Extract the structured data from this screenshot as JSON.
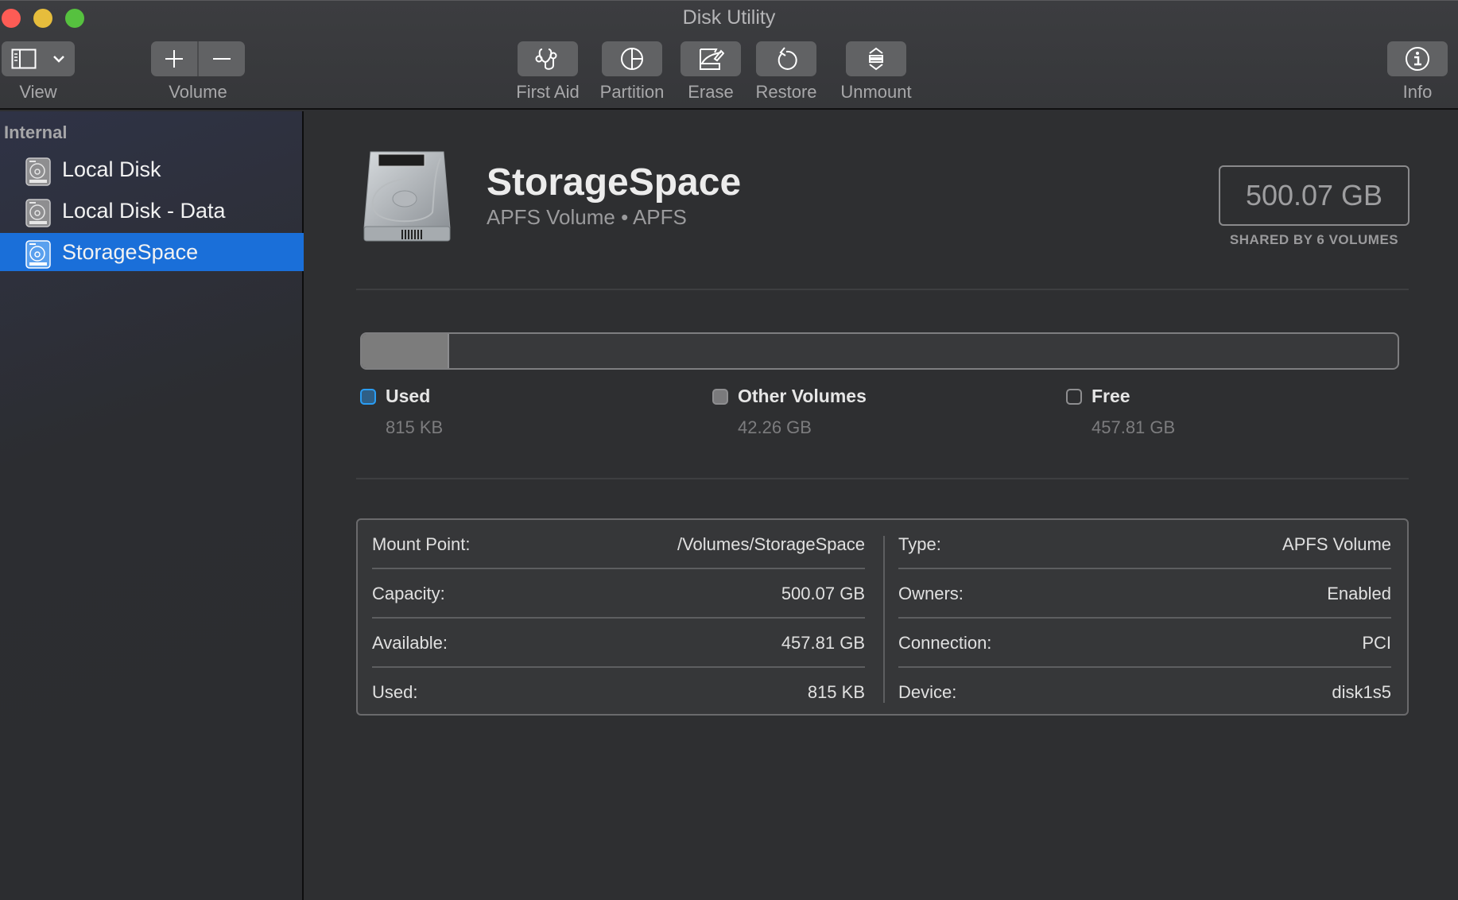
{
  "window": {
    "title": "Disk Utility"
  },
  "toolbar": {
    "view_label": "View",
    "volume_label": "Volume",
    "first_aid_label": "First Aid",
    "partition_label": "Partition",
    "erase_label": "Erase",
    "restore_label": "Restore",
    "unmount_label": "Unmount",
    "info_label": "Info"
  },
  "sidebar": {
    "section": "Internal",
    "items": [
      {
        "label": "Local Disk",
        "icon": "hard-disk-icon",
        "selected": false
      },
      {
        "label": "Local Disk - Data",
        "icon": "hard-disk-icon",
        "selected": false
      },
      {
        "label": "StorageSpace",
        "icon": "hard-disk-icon",
        "selected": true
      }
    ]
  },
  "volume": {
    "name": "StorageSpace",
    "subtitle": "APFS Volume • APFS",
    "capacity": "500.07 GB",
    "shared_note": "SHARED BY 6 VOLUMES"
  },
  "usage": {
    "fill_fraction": 0.0845,
    "legend": [
      {
        "name": "Used",
        "value": "815 KB",
        "color": "#2a9df4",
        "fill": "#2f5f86"
      },
      {
        "name": "Other Volumes",
        "value": "42.26 GB",
        "color": "#8e8e90",
        "fill": "#7a7a7c"
      },
      {
        "name": "Free",
        "value": "457.81 GB",
        "color": "#8e8e90",
        "fill": "transparent"
      }
    ]
  },
  "info": {
    "left": [
      {
        "key": "Mount Point:",
        "value": "/Volumes/StorageSpace"
      },
      {
        "key": "Capacity:",
        "value": "500.07 GB"
      },
      {
        "key": "Available:",
        "value": "457.81 GB"
      },
      {
        "key": "Used:",
        "value": "815 KB"
      }
    ],
    "right": [
      {
        "key": "Type:",
        "value": "APFS Volume"
      },
      {
        "key": "Owners:",
        "value": "Enabled"
      },
      {
        "key": "Connection:",
        "value": "PCI"
      },
      {
        "key": "Device:",
        "value": "disk1s5"
      }
    ]
  },
  "colors": {
    "accent": "#1a6fd9",
    "used": "#2a9df4"
  }
}
